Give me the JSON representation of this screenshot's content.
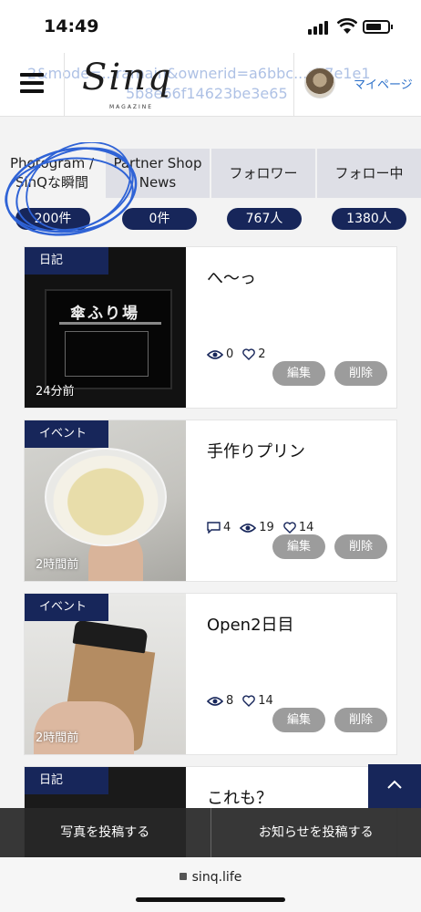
{
  "status_bar": {
    "time": "14:49"
  },
  "header": {
    "url_ghost_line1": "2&mode=...ramain&ownerid=a6bbc...cb7e1e1",
    "url_ghost_line2": "5b8e66f14623be3e65",
    "logo_text": "Sinq",
    "logo_sub": "MAGAZINE",
    "mypage_label": "マイページ"
  },
  "tabs": [
    {
      "label_line1": "Photogram /",
      "label_line2": "SinQな瞬間",
      "count": "200件",
      "active": true
    },
    {
      "label_line1": "Partner Shop",
      "label_line2": "News",
      "count": "0件",
      "active": false
    },
    {
      "label_line1": "フォロワー",
      "label_line2": "",
      "count": "767人",
      "active": false
    },
    {
      "label_line1": "フォロー中",
      "label_line2": "",
      "count": "1380人",
      "active": false
    }
  ],
  "posts": [
    {
      "badge": "日記",
      "ago": "24分前",
      "title": "へ〜っ",
      "comments": null,
      "views": "0",
      "likes": "2",
      "image_text": "傘ふり場"
    },
    {
      "badge": "イベント",
      "ago": "2時間前",
      "title": "手作りプリン",
      "comments": "4",
      "views": "19",
      "likes": "14"
    },
    {
      "badge": "イベント",
      "ago": "2時間前",
      "title": "Open2日目",
      "comments": null,
      "views": "8",
      "likes": "14"
    },
    {
      "badge": "日記",
      "ago": "",
      "title": "これも？"
    }
  ],
  "actions": {
    "edit": "編集",
    "delete": "削除"
  },
  "bottom_bar": {
    "post_photo": "写真を投稿する",
    "post_notice": "お知らせを投稿する"
  },
  "browser": {
    "domain": "sinq.life"
  },
  "colors": {
    "navy": "#17265a",
    "button_gray": "#9c9c9c",
    "link_blue": "#2a6fc9",
    "scribble_blue": "#2f63d6"
  }
}
